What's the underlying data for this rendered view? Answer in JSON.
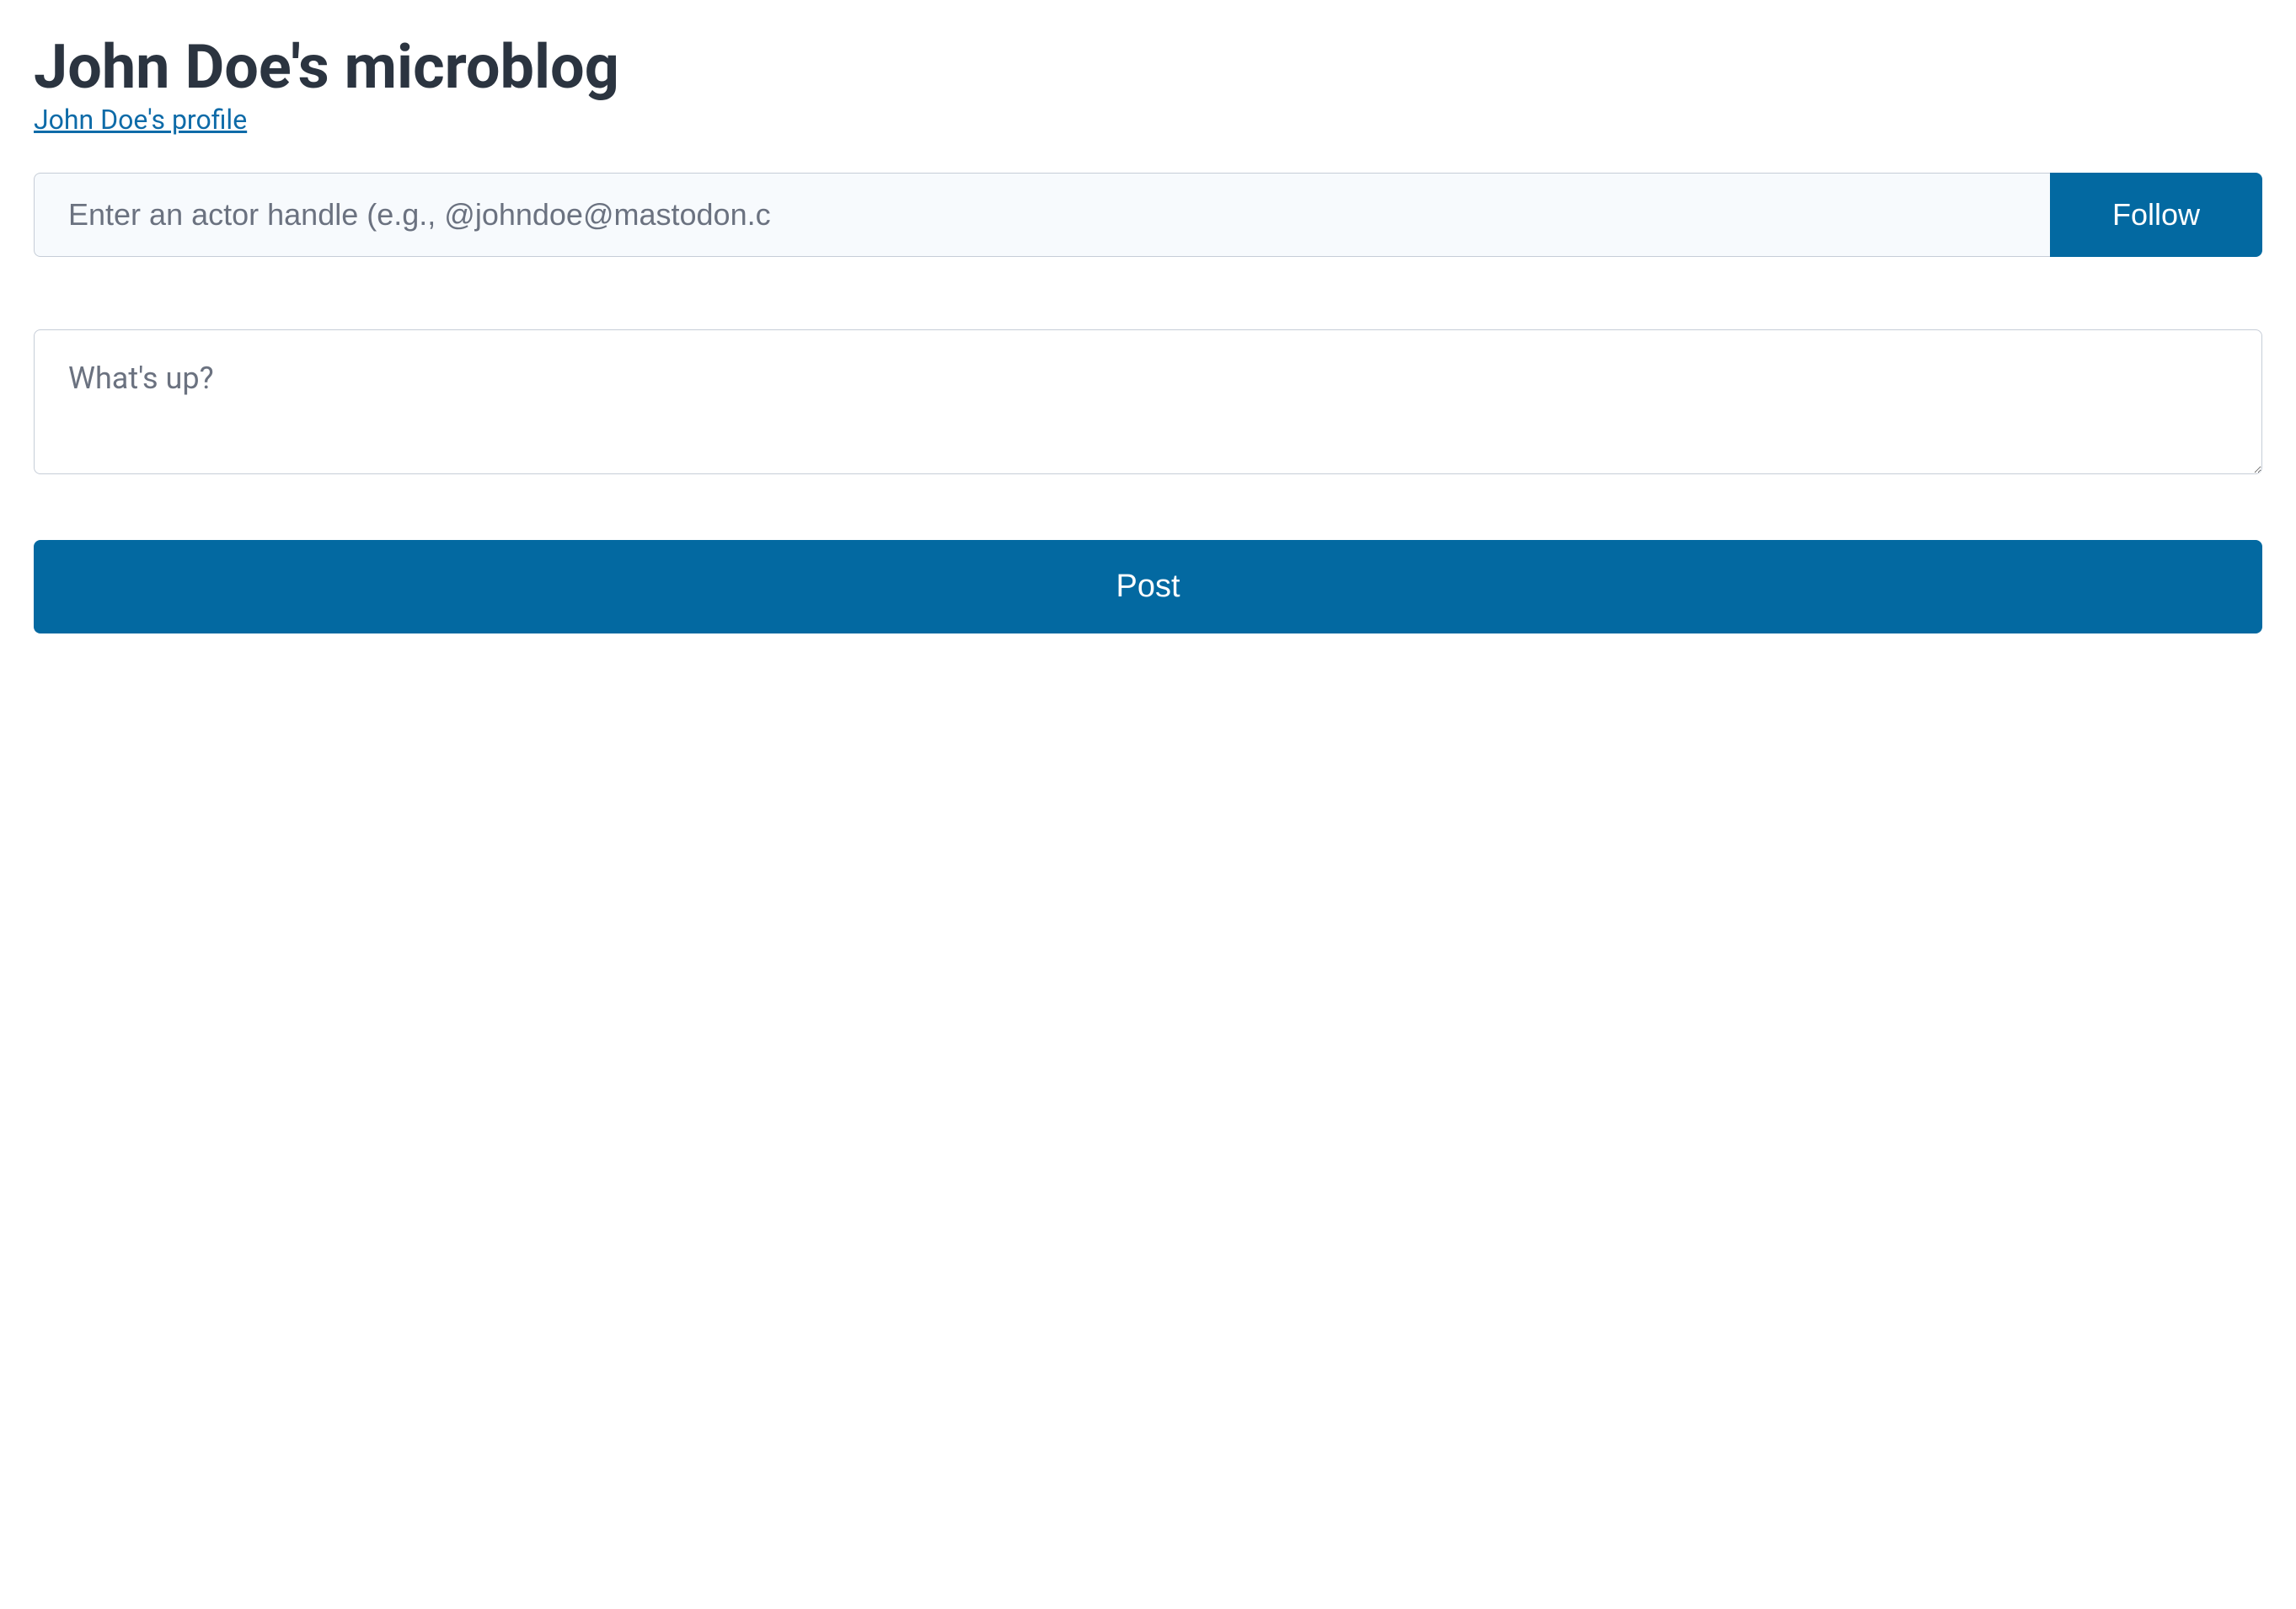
{
  "header": {
    "title": "John Doe's microblog",
    "profile_link_text": "John Doe's profile"
  },
  "follow": {
    "placeholder": "Enter an actor handle (e.g., @johndoe@mastodon.c",
    "button_label": "Follow"
  },
  "compose": {
    "placeholder": "What's up?",
    "post_button_label": "Post"
  }
}
